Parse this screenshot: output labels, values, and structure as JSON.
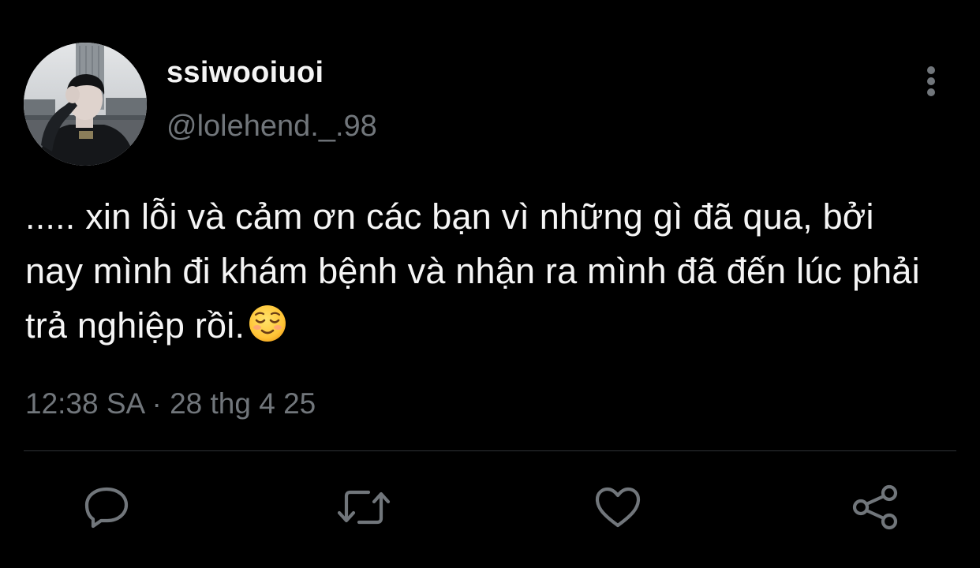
{
  "tweet": {
    "display_name": "ssiwooiuoi",
    "handle": "@lolehend._.98",
    "text": "..... xin lỗi và cảm ơn các bạn vì những gì đã qua, bởi nay mình đi khám bệnh và nhận ra mình đã đến lúc phải trả nghiệp rồi.",
    "emoji": "smiling-face-emoji",
    "timestamp": "12:38 SA · 28 thg 4 25"
  },
  "actions": {
    "reply_icon": "reply-icon",
    "retweet_icon": "retweet-icon",
    "like_icon": "heart-icon",
    "share_icon": "share-icon",
    "more_icon": "more-vertical-icon"
  },
  "colors": {
    "background": "#000000",
    "primary_text": "#f5f5f5",
    "secondary_text": "#71767b",
    "icon": "#71767b",
    "divider": "#2f3336"
  }
}
